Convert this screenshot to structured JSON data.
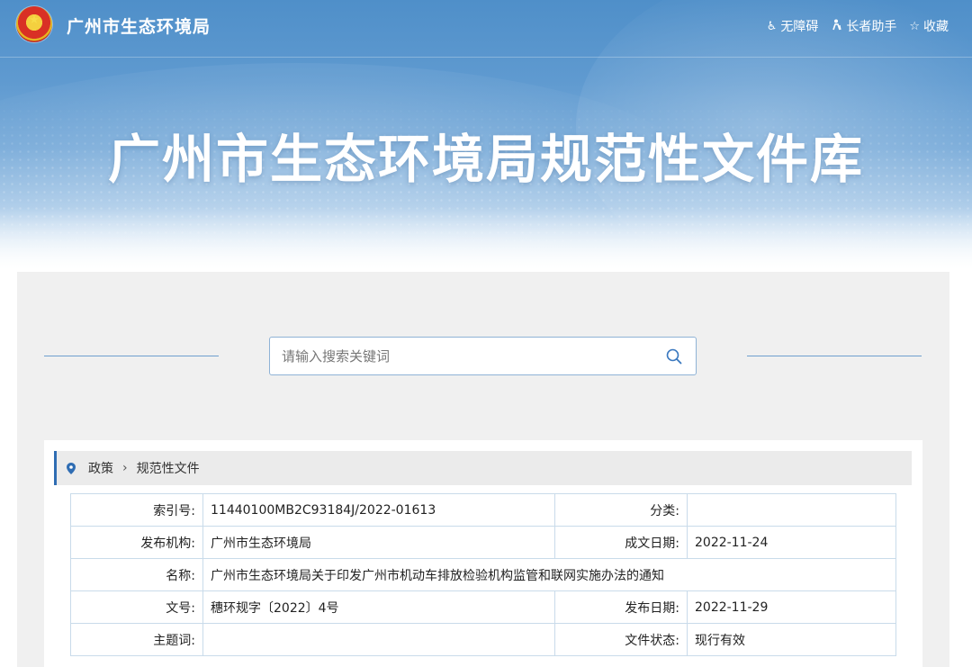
{
  "header": {
    "site_name": "广州市生态环境局",
    "tools": [
      {
        "label": "无障碍",
        "icon": "wheelchair-icon"
      },
      {
        "label": "长者助手",
        "icon": "elder-icon"
      },
      {
        "label": "收藏",
        "icon": "star-icon"
      }
    ]
  },
  "banner": {
    "title": "广州市生态环境局规范性文件库"
  },
  "search": {
    "placeholder": "请输入搜索关键词",
    "value": ""
  },
  "breadcrumb": {
    "items": [
      "政策",
      "规范性文件"
    ]
  },
  "info": {
    "index_no": {
      "label": "索引号:",
      "value": "11440100MB2C93184J/2022-01613"
    },
    "category": {
      "label": "分类:",
      "value": ""
    },
    "publisher": {
      "label": "发布机构:",
      "value": "广州市生态环境局"
    },
    "created_date": {
      "label": "成文日期:",
      "value": "2022-11-24"
    },
    "name": {
      "label": "名称:",
      "value": "广州市生态环境局关于印发广州市机动车排放检验机构监管和联网实施办法的通知"
    },
    "doc_no": {
      "label": "文号:",
      "value": "穗环规字〔2022〕4号"
    },
    "publish_date": {
      "label": "发布日期:",
      "value": "2022-11-29"
    },
    "keywords": {
      "label": "主题词:",
      "value": ""
    },
    "status": {
      "label": "文件状态:",
      "value": "现行有效"
    }
  },
  "colors": {
    "accent": "#2f6db3",
    "table_border": "#c9dbea",
    "panel_bg": "#f0f0f0"
  }
}
